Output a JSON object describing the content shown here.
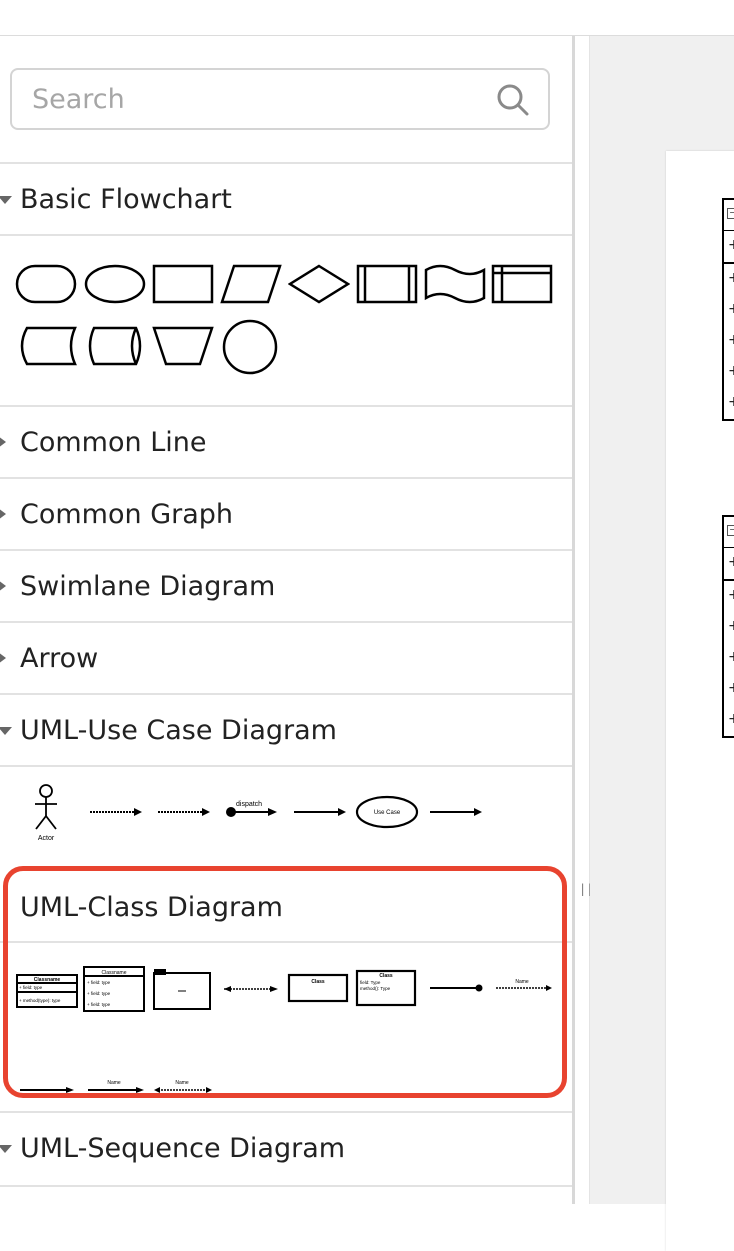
{
  "search": {
    "placeholder": "Search"
  },
  "sections": {
    "basic_flowchart": "Basic Flowchart",
    "common_line": "Common Line",
    "common_graph": "Common Graph",
    "swimlane": "Swimlane Diagram",
    "arrow": "Arrow",
    "uml_use_case": "UML-Use Case Diagram",
    "uml_class": "UML-Class Diagram",
    "uml_sequence": "UML-Sequence Diagram"
  },
  "use_case_shapes": {
    "actor_label": "Actor",
    "dispatch_label": "dispatch",
    "use_case_label": "Use Case"
  },
  "class_shapes": {
    "classname": "Classname",
    "field": "+ field: type",
    "method": "+ method(type): type",
    "class": "Class",
    "field_type": "field: Type",
    "method_type": "method(): Type",
    "name": "Name"
  },
  "canvas": {
    "row_marker": "+"
  },
  "colors": {
    "highlight": "#e8432f"
  }
}
